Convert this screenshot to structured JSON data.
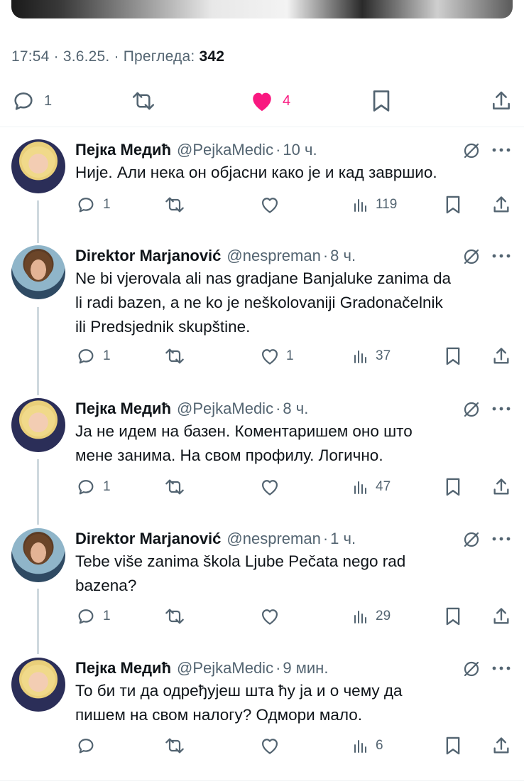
{
  "tweet": {
    "time": "17:54",
    "date": "3.6.25.",
    "views_label": "Прегледа:",
    "views": "342",
    "replies": "1",
    "likes": "4"
  },
  "colors": {
    "like": "#f91880",
    "muted_text": "#536471",
    "text": "#0f1419",
    "thread_line": "#cfd9de"
  },
  "icons": [
    "reply-icon",
    "retweet-icon",
    "like-icon",
    "bookmark-icon",
    "share-icon",
    "views-icon",
    "mute-icon",
    "more-icon"
  ],
  "replies": [
    {
      "name": "Пејка Медић",
      "handle": "@PejkaMedic",
      "time": "10 ч.",
      "lines": [
        "Није. Али нека он објасни како је и кад завршио."
      ],
      "replies": "1",
      "likes": "",
      "views": "119"
    },
    {
      "name": "Direktor Marjanović",
      "handle": "@nespreman",
      "time": "8 ч.",
      "lines": [
        "Ne bi vjerovala ali nas gradjane Banjaluke zanima da",
        "li radi bazen, a ne ko je neškolovaniji Gradonačelnik",
        "ili Predsjednik skupštine."
      ],
      "replies": "1",
      "likes": "1",
      "views": "37"
    },
    {
      "name": "Пејка Медић",
      "handle": "@PejkaMedic",
      "time": "8 ч.",
      "lines": [
        "Ја не идем на базен. Коментаришем оно што",
        "мене занима. На свом профилу. Логично."
      ],
      "replies": "1",
      "likes": "",
      "views": "47"
    },
    {
      "name": "Direktor Marjanović",
      "handle": "@nespreman",
      "time": "1 ч.",
      "lines": [
        "Tebe više zanima škola Ljube Pečata nego rad",
        "bazena?"
      ],
      "replies": "1",
      "likes": "",
      "views": "29"
    },
    {
      "name": "Пејка Медић",
      "handle": "@PejkaMedic",
      "time": "9 мин.",
      "lines": [
        "То би ти да одређујеш шта ћу ја и о чему да",
        "пишем на свом налогу? Одмори мало."
      ],
      "replies": "",
      "likes": "",
      "views": "6"
    }
  ]
}
